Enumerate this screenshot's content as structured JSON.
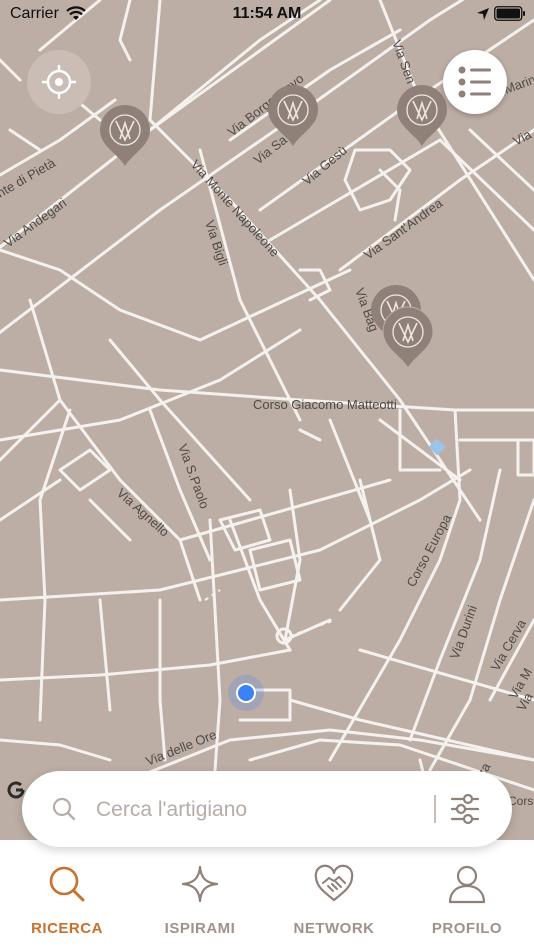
{
  "status_bar": {
    "carrier": "Carrier",
    "time": "11:54 AM"
  },
  "map": {
    "street_labels": {
      "via_senato": "Via Sen",
      "via_marina": "Marin",
      "via_borgonuovo": "Via Borgonuovo",
      "via_sant_andrea_top": "Via Sa",
      "via_monte_di_pieta": "nte di Pietà",
      "via_andegari": "Via Andegari",
      "via_monte_napoleone": "Via Monte Napoleone",
      "via_gesu": "Via Gesù",
      "via_bigli": "Via Bigli",
      "via_sant_andrea": "Via Sant'Andrea",
      "via_bagutta": "Via Bag",
      "corso_giacomo_matteotti": "Corso Giacomo Matteotti",
      "via_s_paolo": "Via S.Paolo",
      "via_agnello": "Via Agnello",
      "corso_europa": "Corso Europa",
      "via_durini": "Via Durini",
      "via_cerva": "Via Cerva",
      "via_delle_ore": "Via delle Ore",
      "via_edge": "Via",
      "via_m_edge": "Via M",
      "via_za_edge": "za",
      "via_top_right": "Via"
    },
    "attribution": "Cors"
  },
  "search": {
    "placeholder": "Cerca l'artigiano"
  },
  "tabs": [
    {
      "label": "RICERCA",
      "active": true
    },
    {
      "label": "ISPIRAMI",
      "active": false
    },
    {
      "label": "NETWORK",
      "active": false
    },
    {
      "label": "PROFILO",
      "active": false
    }
  ],
  "colors": {
    "accent": "#c8702c",
    "map_bg": "#bdaea5",
    "pin": "#8f817a",
    "tab_inactive": "#9e928b",
    "location_dot": "#3c82f6"
  },
  "icons": [
    "wifi-icon",
    "location-arrow-icon",
    "battery-icon",
    "locate-icon",
    "list-icon",
    "pin-icon",
    "google-logo-icon",
    "search-icon",
    "filter-icon",
    "ispirami-star-icon",
    "network-heart-icon",
    "profile-icon"
  ]
}
